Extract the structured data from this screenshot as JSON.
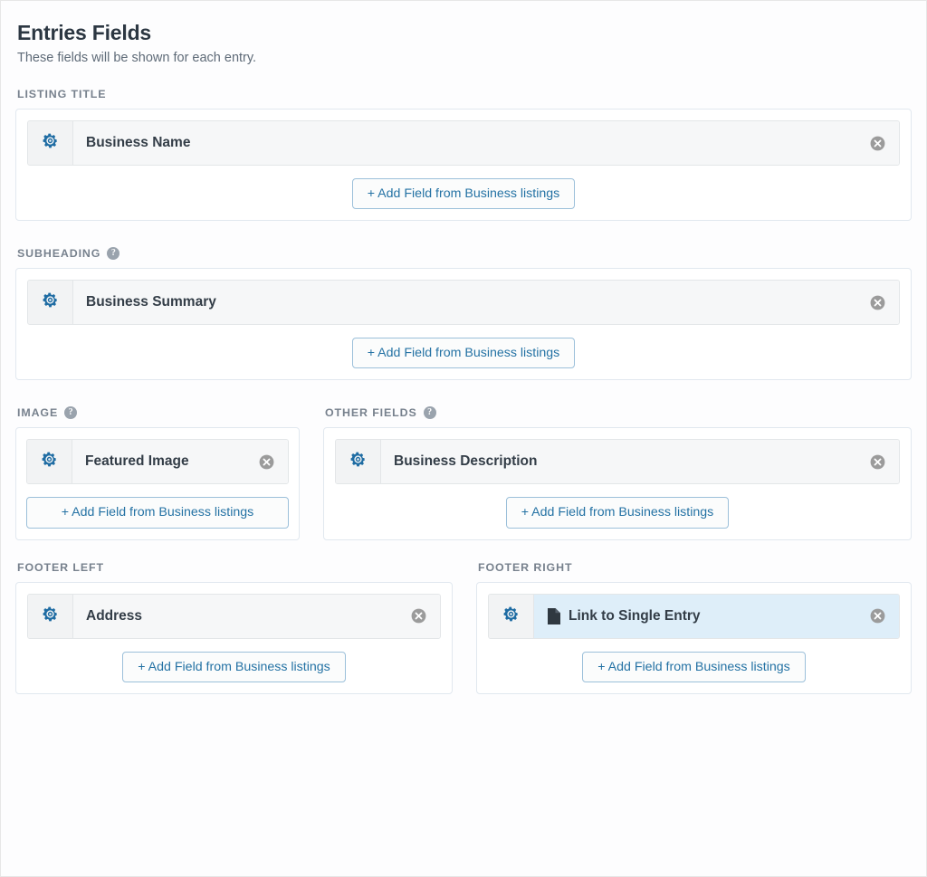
{
  "header": {
    "title": "Entries Fields",
    "subtitle": "These fields will be shown for each entry."
  },
  "icons": {
    "gear": "gear-icon",
    "remove": "remove-circle-icon",
    "help": "?",
    "document": "document-icon"
  },
  "colors": {
    "accent_blue": "#2472a4",
    "gear_blue": "#1f6ca3",
    "highlight_bg": "#deeef9",
    "row_bg": "#f6f7f8",
    "card_border": "#e1e8ef",
    "label_gray": "#77818d",
    "title_dark": "#2c3742"
  },
  "sections": [
    {
      "id": "listing-title",
      "label": "LISTING TITLE",
      "has_help": false,
      "button_align": "center",
      "fields": [
        {
          "label": "Business Name",
          "highlight": false,
          "has_doc_icon": false
        }
      ],
      "add_button": "+ Add Field from Business listings"
    },
    {
      "id": "subheading",
      "label": "SUBHEADING",
      "has_help": true,
      "button_align": "center",
      "fields": [
        {
          "label": "Business Summary",
          "highlight": false,
          "has_doc_icon": false
        }
      ],
      "add_button": "+ Add Field from Business listings"
    },
    {
      "id": "image",
      "label": "IMAGE",
      "has_help": true,
      "button_align": "stretch",
      "fields": [
        {
          "label": "Featured Image",
          "highlight": false,
          "has_doc_icon": false
        }
      ],
      "add_button": "+ Add Field from Business listings"
    },
    {
      "id": "other-fields",
      "label": "OTHER FIELDS",
      "has_help": true,
      "button_align": "center",
      "fields": [
        {
          "label": "Business Description",
          "highlight": false,
          "has_doc_icon": false
        }
      ],
      "add_button": "+ Add Field from Business listings"
    },
    {
      "id": "footer-left",
      "label": "FOOTER LEFT",
      "has_help": false,
      "button_align": "center",
      "fields": [
        {
          "label": "Address",
          "highlight": false,
          "has_doc_icon": false
        }
      ],
      "add_button": "+ Add Field from Business listings"
    },
    {
      "id": "footer-right",
      "label": "FOOTER RIGHT",
      "has_help": false,
      "button_align": "center",
      "fields": [
        {
          "label": "Link to Single Entry",
          "highlight": true,
          "has_doc_icon": true
        }
      ],
      "add_button": "+ Add Field from Business listings"
    }
  ]
}
